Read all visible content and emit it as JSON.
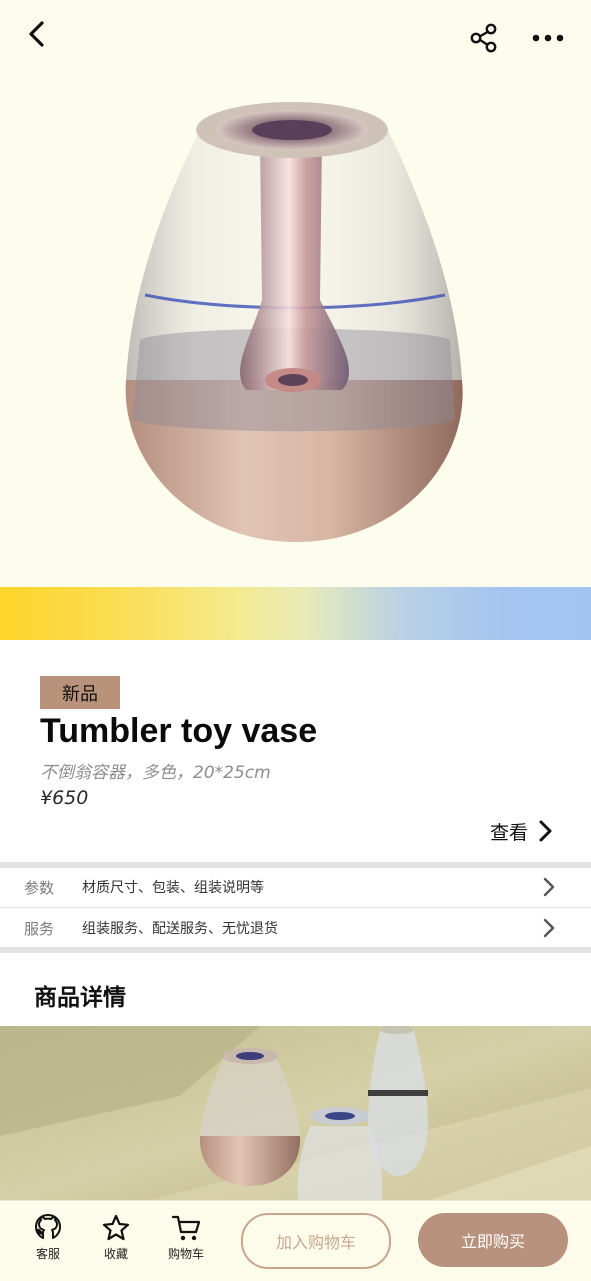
{
  "product": {
    "badge": "新品",
    "title": "Tumbler toy vase",
    "subtitle": "不倒翁容器，多色，20*25cm",
    "price": "¥650",
    "view_label": "查看"
  },
  "specs": [
    {
      "key": "参数",
      "value": "材质尺寸、包装、组装说明等"
    },
    {
      "key": "服务",
      "value": "组装服务、配送服务、无忧退货"
    }
  ],
  "details": {
    "title": "商品详情"
  },
  "bottom": {
    "tools": [
      {
        "label": "客服",
        "icon": "github-octocat-icon"
      },
      {
        "label": "收藏",
        "icon": "star-icon"
      },
      {
        "label": "购物车",
        "icon": "cart-icon"
      }
    ],
    "add_to_cart": "加入购物车",
    "buy_now": "立即购买"
  },
  "colors": {
    "accent": "#b8927c",
    "hero_bg": "#fdfdee",
    "badge_bg": "#b8927a",
    "gradient": [
      "#fdd52a",
      "#f4ea8e",
      "#a5c5f0"
    ]
  }
}
